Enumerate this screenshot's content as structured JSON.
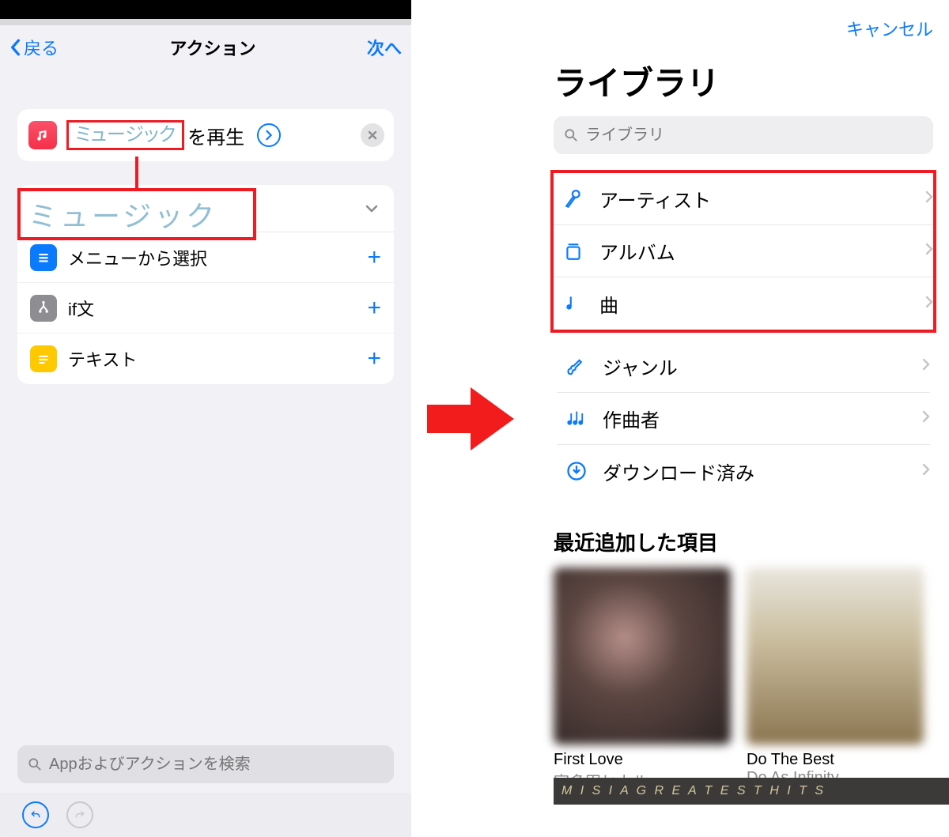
{
  "left": {
    "nav": {
      "back": "戻る",
      "title": "アクション",
      "next": "次へ"
    },
    "action": {
      "token": "ミュージック",
      "suffix": "を再生"
    },
    "token_enlarged": "ミュージック",
    "suggestions": [
      {
        "id": "menu",
        "label": "メニューから選択"
      },
      {
        "id": "if",
        "label": "if文"
      },
      {
        "id": "text",
        "label": "テキスト"
      }
    ],
    "search_placeholder": "Appおよびアクションを検索"
  },
  "right": {
    "cancel": "キャンセル",
    "title": "ライブラリ",
    "search_placeholder": "ライブラリ",
    "categories": [
      {
        "id": "artist",
        "label": "アーティスト",
        "highlight": true
      },
      {
        "id": "album",
        "label": "アルバム",
        "highlight": true
      },
      {
        "id": "song",
        "label": "曲",
        "highlight": true
      },
      {
        "id": "genre",
        "label": "ジャンル",
        "highlight": false
      },
      {
        "id": "composer",
        "label": "作曲者",
        "highlight": false
      },
      {
        "id": "downloaded",
        "label": "ダウンロード済み",
        "highlight": false
      }
    ],
    "recent_title": "最近追加した項目",
    "albums": [
      {
        "title": "First Love",
        "artist": "宇多田ヒカル"
      },
      {
        "title": "Do The Best",
        "artist": "Do As Infinity"
      }
    ],
    "banner": "M I S I A   G R E A T E S T  H I T S"
  }
}
